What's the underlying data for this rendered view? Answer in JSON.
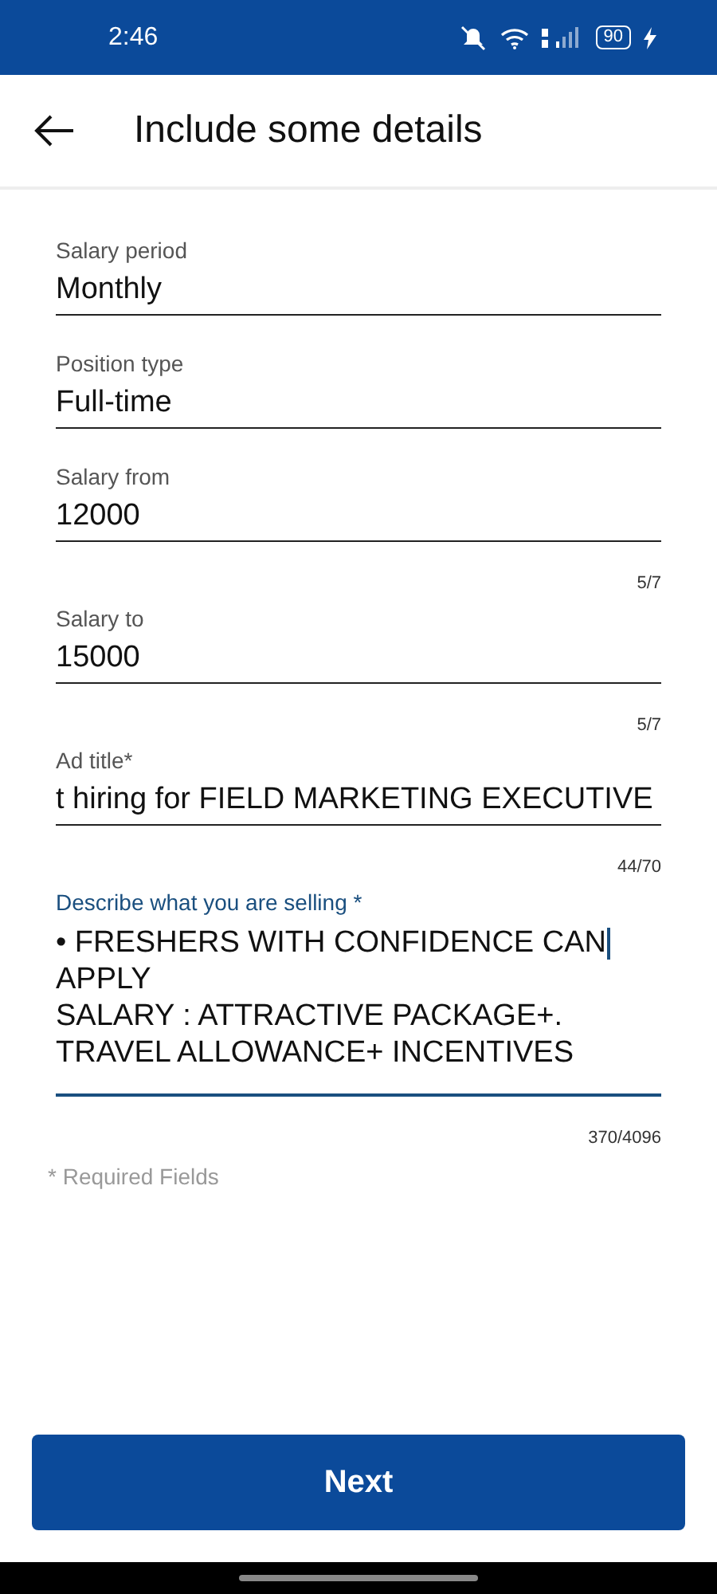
{
  "status_bar": {
    "time": "2:46",
    "battery": "90"
  },
  "header": {
    "title": "Include some details"
  },
  "fields": [
    {
      "label": "Salary period",
      "value": "Monthly",
      "focused": false
    },
    {
      "label": "Position type",
      "value": "Full-time",
      "focused": false
    },
    {
      "label": "Salary from",
      "value": "12000",
      "counter": "5/7",
      "focused": false
    },
    {
      "label": "Salary to",
      "value": "15000",
      "counter": "5/7",
      "focused": false
    },
    {
      "label": "Ad title*",
      "value": "t hiring for FIELD MARKETING EXECUTIVE",
      "counter": "44/70",
      "focused": false
    },
    {
      "label": "Describe what you are selling *",
      "lines": [
        "• FRESHERS WITH CONFIDENCE CAN",
        "APPLY",
        "SALARY : ATTRACTIVE PACKAGE+.",
        "TRAVEL ALLOWANCE+ INCENTIVES"
      ],
      "counter": "370/4096",
      "focused": true
    }
  ],
  "note": "* Required Fields",
  "button": "Next"
}
